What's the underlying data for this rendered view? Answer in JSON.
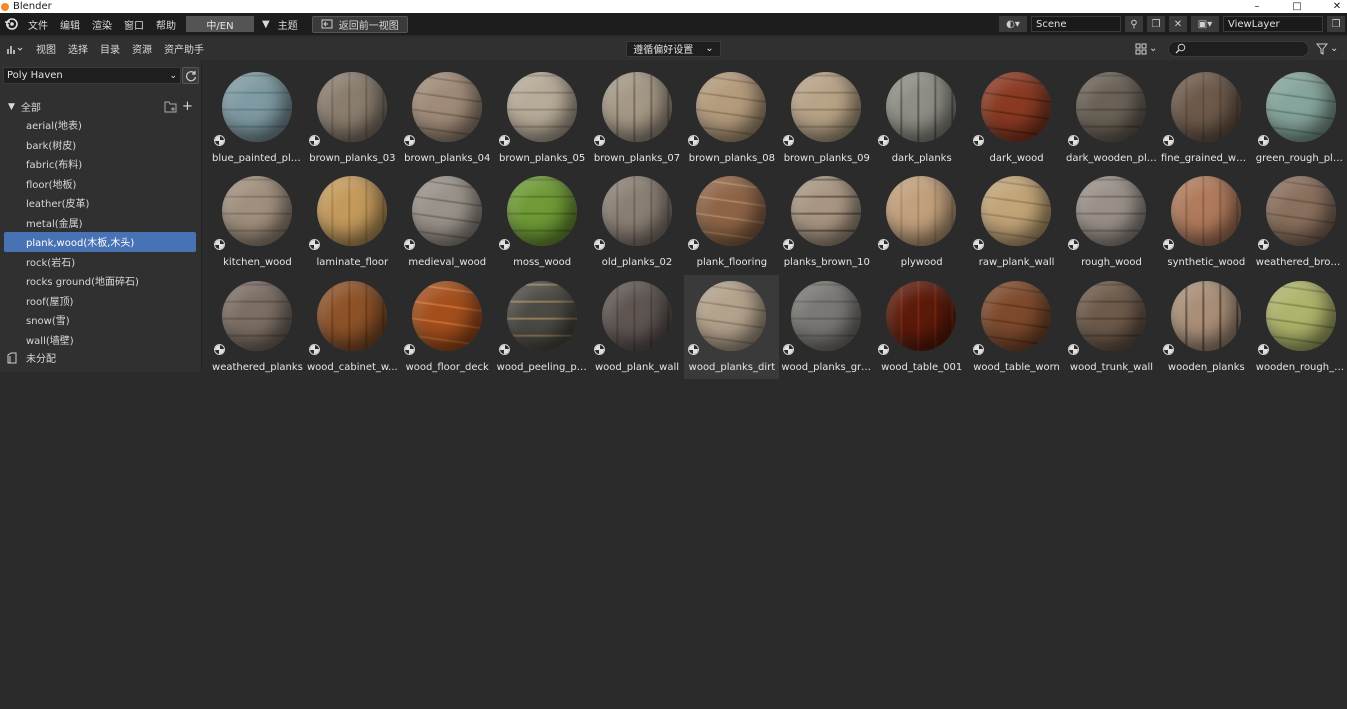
{
  "os_title": "Blender",
  "window_controls": [
    "–",
    "□",
    "✕"
  ],
  "menu": {
    "items": [
      "文件",
      "编辑",
      "渲染",
      "窗口",
      "帮助"
    ],
    "language_toggle": "中/EN",
    "theme_label": "主题",
    "back_button": "返回前一视图"
  },
  "scene": {
    "label": "Scene",
    "view_layer": "ViewLayer"
  },
  "editor_header": {
    "menus": [
      "视图",
      "选择",
      "目录",
      "资源",
      "资产助手"
    ],
    "import_method": "遵循偏好设置",
    "search_placeholder": ""
  },
  "sidebar": {
    "library": "Poly Haven",
    "root_label": "全部",
    "categories": [
      {
        "label": "aerial(地表)",
        "active": false
      },
      {
        "label": "bark(树皮)",
        "active": false
      },
      {
        "label": "fabric(布料)",
        "active": false
      },
      {
        "label": "floor(地板)",
        "active": false
      },
      {
        "label": "leather(皮革)",
        "active": false
      },
      {
        "label": "metal(金属)",
        "active": false
      },
      {
        "label": "plank,wood(木板,木头)",
        "active": true
      },
      {
        "label": "rock(岩石)",
        "active": false
      },
      {
        "label": "rocks ground(地面碎石)",
        "active": false
      },
      {
        "label": "roof(屋顶)",
        "active": false
      },
      {
        "label": "snow(雪)",
        "active": false
      },
      {
        "label": "wall(墙壁)",
        "active": false
      }
    ],
    "unassigned": "未分配"
  },
  "assets": [
    {
      "name": "blue_painted_pla...",
      "color": "#7f9aa3",
      "stripe": "#5d7d86"
    },
    {
      "name": "brown_planks_03",
      "color": "#8a7d6e",
      "stripe": "#6b5f52"
    },
    {
      "name": "brown_planks_04",
      "color": "#a08b78",
      "stripe": "#7a6656"
    },
    {
      "name": "brown_planks_05",
      "color": "#b7ab99",
      "stripe": "#8f826f"
    },
    {
      "name": "brown_planks_07",
      "color": "#a59886",
      "stripe": "#6d6050"
    },
    {
      "name": "brown_planks_08",
      "color": "#b49b7c",
      "stripe": "#8d765a"
    },
    {
      "name": "brown_planks_09",
      "color": "#b8a386",
      "stripe": "#8e7a60"
    },
    {
      "name": "dark_planks",
      "color": "#8f8e86",
      "stripe": "#4f4d47"
    },
    {
      "name": "dark_wood",
      "color": "#8a3a22",
      "stripe": "#5e2414"
    },
    {
      "name": "dark_wooden_pla...",
      "color": "#6b6257",
      "stripe": "#4c453d"
    },
    {
      "name": "fine_grained_wood",
      "color": "#6e5a4b",
      "stripe": "#574538"
    },
    {
      "name": "green_rough_pla...",
      "color": "#86a59c",
      "stripe": "#5f7d74"
    },
    {
      "name": "kitchen_wood",
      "color": "#a08f7d",
      "stripe": "#7d6d5d"
    },
    {
      "name": "laminate_floor",
      "color": "#c49a5c",
      "stripe": "#a17a43"
    },
    {
      "name": "medieval_wood",
      "color": "#9a928a",
      "stripe": "#6e6760"
    },
    {
      "name": "moss_wood",
      "color": "#6f9a36",
      "stripe": "#4f7624"
    },
    {
      "name": "old_planks_02",
      "color": "#8a7f74",
      "stripe": "#675e55"
    },
    {
      "name": "plank_flooring",
      "color": "#8e6446",
      "stripe": "#b58a62"
    },
    {
      "name": "planks_brown_10",
      "color": "#a89682",
      "stripe": "#5a4c3e"
    },
    {
      "name": "plywood",
      "color": "#c2a07c",
      "stripe": "#a4845f"
    },
    {
      "name": "raw_plank_wall",
      "color": "#c2a477",
      "stripe": "#9b7f58"
    },
    {
      "name": "rough_wood",
      "color": "#999088",
      "stripe": "#6e665f"
    },
    {
      "name": "synthetic_wood",
      "color": "#b07a5c",
      "stripe": "#8a5a40"
    },
    {
      "name": "weathered_brow...",
      "color": "#8a6f5d",
      "stripe": "#6b5444"
    },
    {
      "name": "weathered_planks",
      "color": "#7c6e64",
      "stripe": "#5c5048"
    },
    {
      "name": "wood_cabinet_w...",
      "color": "#8e5228",
      "stripe": "#6a3a18"
    },
    {
      "name": "wood_floor_deck",
      "color": "#a44e1c",
      "stripe": "#d07636"
    },
    {
      "name": "wood_peeling_pai...",
      "color": "#4c4a44",
      "stripe": "#a98a62"
    },
    {
      "name": "wood_plank_wall",
      "color": "#5f5652",
      "stripe": "#463f3c"
    },
    {
      "name": "wood_planks_dirt",
      "color": "#b3a28c",
      "stripe": "#8c7b66"
    },
    {
      "name": "wood_planks_grey",
      "color": "#7a7874",
      "stripe": "#5e5c59"
    },
    {
      "name": "wood_table_001",
      "color": "#5c1a0a",
      "stripe": "#7e2a12"
    },
    {
      "name": "wood_table_worn",
      "color": "#7e4a2c",
      "stripe": "#5e341c"
    },
    {
      "name": "wood_trunk_wall",
      "color": "#6d5a4a",
      "stripe": "#4d3d30"
    },
    {
      "name": "wooden_planks",
      "color": "#a98f78",
      "stripe": "#4e3b2e"
    },
    {
      "name": "wooden_rough_pl...",
      "color": "#aeb46a",
      "stripe": "#7f8446"
    }
  ],
  "colors": {
    "accent": "#4772b3",
    "background": "#2b2b2b",
    "header": "#303030",
    "topbar": "#1d1d1d"
  }
}
